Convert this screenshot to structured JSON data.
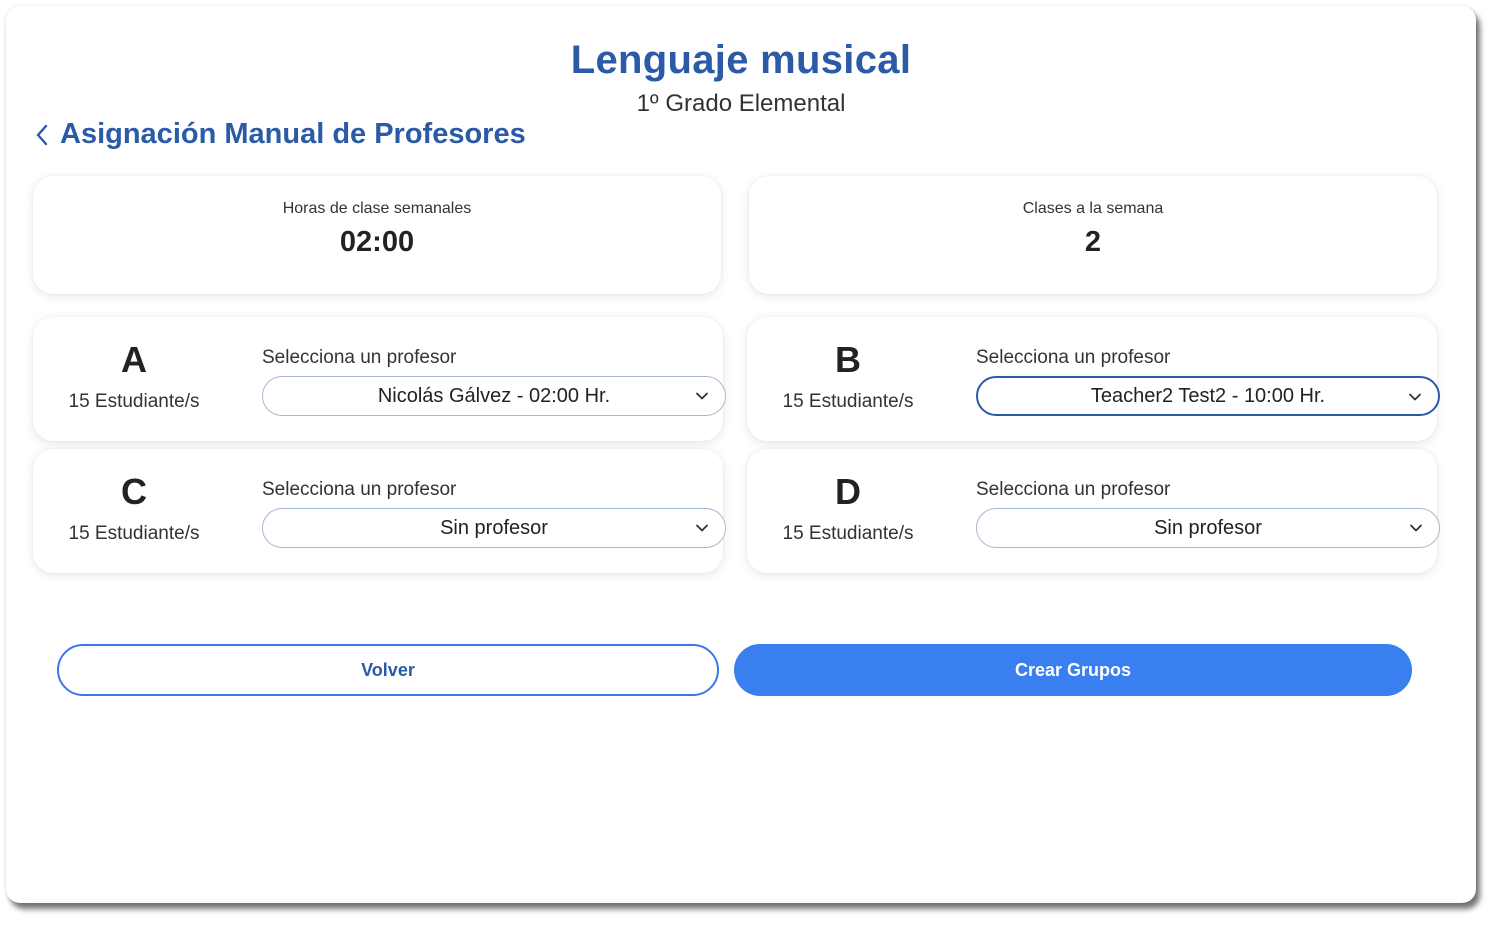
{
  "header": {
    "title": "Lenguaje musical",
    "subtitle": "1º Grado Elemental",
    "section_title": "Asignación Manual de Profesores"
  },
  "stats": {
    "hours_label": "Horas de clase semanales",
    "hours_value": "02:00",
    "classes_label": "Clases a la semana",
    "classes_value": "2"
  },
  "groups": [
    {
      "letter": "A",
      "students": "15 Estudiante/s",
      "select_label": "Selecciona un profesor",
      "selected": "Nicolás Gálvez - 02:00 Hr."
    },
    {
      "letter": "B",
      "students": "15 Estudiante/s",
      "select_label": "Selecciona un profesor",
      "selected": "Teacher2 Test2 - 10:00 Hr."
    },
    {
      "letter": "C",
      "students": "15 Estudiante/s",
      "select_label": "Selecciona un profesor",
      "selected": "Sin profesor"
    },
    {
      "letter": "D",
      "students": "15 Estudiante/s",
      "select_label": "Selecciona un profesor",
      "selected": "Sin profesor"
    }
  ],
  "actions": {
    "back_label": "Volver",
    "create_label": "Crear Grupos"
  },
  "icons": {
    "back": "chevron-left-icon",
    "dropdown": "chevron-down-icon"
  },
  "colors": {
    "primary_text": "#2b5aa6",
    "primary_button": "#3a7ff0",
    "outline_button": "#3a78e8"
  }
}
